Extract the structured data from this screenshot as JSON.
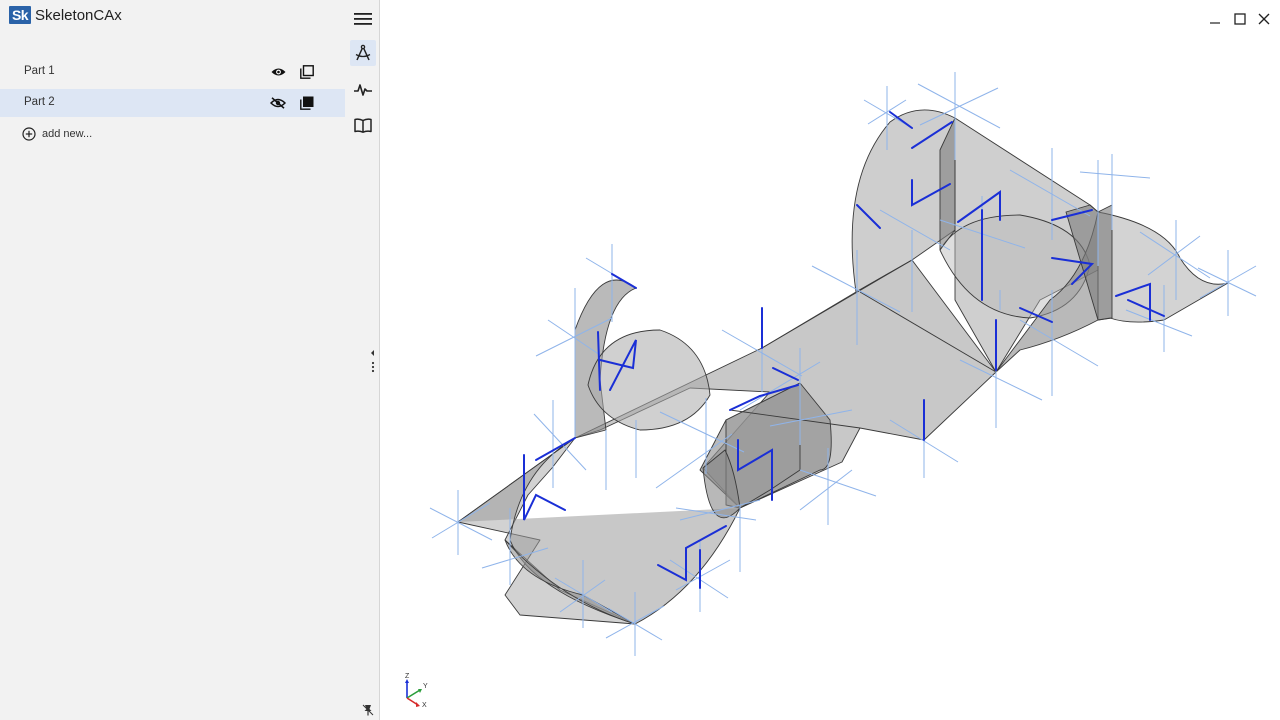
{
  "app": {
    "logo_text": "Sk",
    "title": "SkeletonCAx"
  },
  "parts": [
    {
      "label": "Part 1",
      "visibility_icon": "eye-icon",
      "layer_icon": "copy-outline-icon",
      "selected": false
    },
    {
      "label": "Part 2",
      "visibility_icon": "eye-off-icon",
      "layer_icon": "copy-filled-icon",
      "selected": true
    }
  ],
  "add_new_label": "add new...",
  "toolbar": [
    "menu-icon",
    "compass-drafting-icon",
    "signal-wave-icon",
    "open-book-icon"
  ],
  "triad": {
    "z": "Z",
    "y": "Y",
    "x": "X"
  },
  "colors": {
    "accent": "#2a62a8",
    "selection": "#dde6f4",
    "edge_blue": "#1a2fd6",
    "ray_blue": "#8fb4ea",
    "surface_gray": "#9e9e9e"
  }
}
